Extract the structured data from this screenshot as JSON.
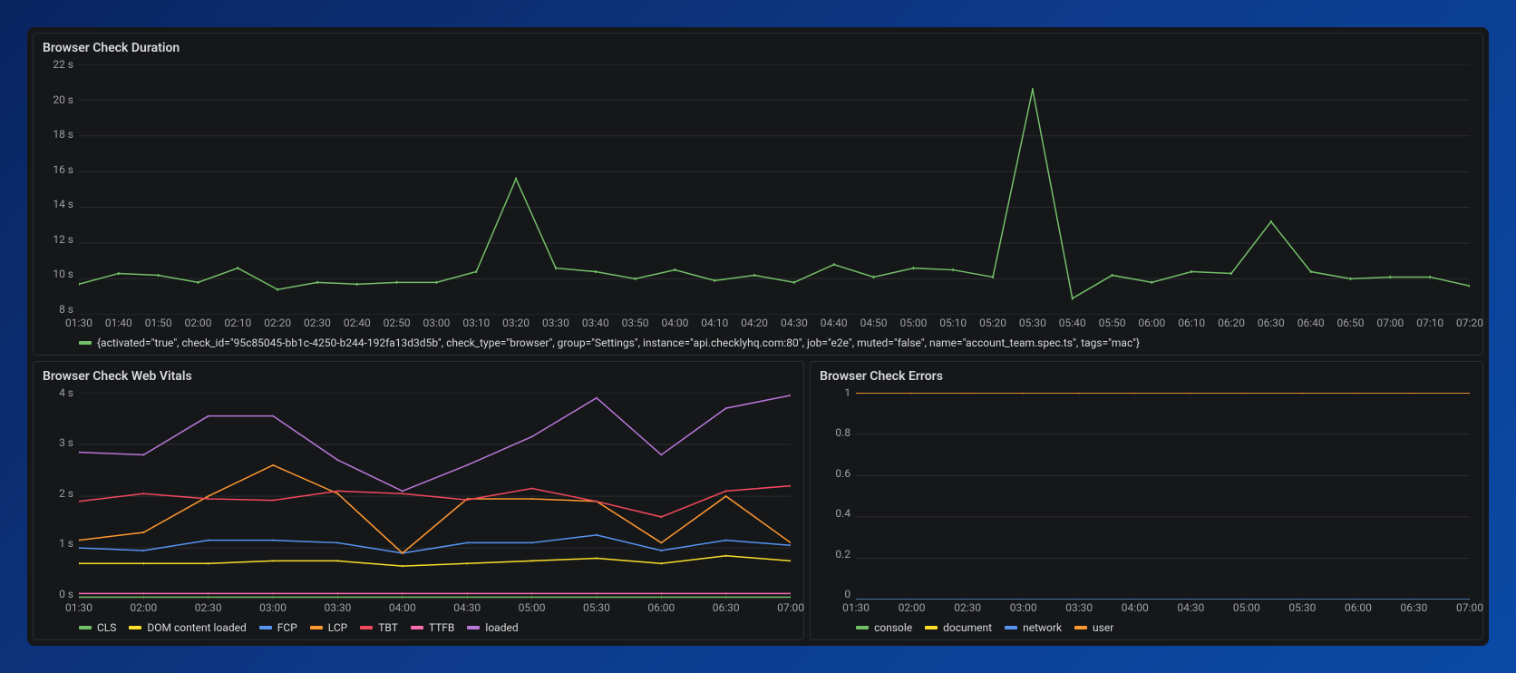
{
  "panels": {
    "duration": {
      "title": "Browser Check Duration"
    },
    "vitals": {
      "title": "Browser Check Web Vitals"
    },
    "errors": {
      "title": "Browser Check Errors"
    }
  },
  "colors": {
    "green": "#73bf69",
    "yellow": "#fade2a",
    "blue": "#5794f2",
    "orange": "#ff9830",
    "red": "#f2495c",
    "teal": "#19d4d4",
    "pink": "#fa6db0",
    "purple": "#b877d9"
  },
  "chart_data": [
    {
      "id": "duration",
      "type": "line",
      "title": "Browser Check Duration",
      "xlabel": "",
      "ylabel": "",
      "ylim": [
        8,
        22
      ],
      "yticks": [
        "22 s",
        "20 s",
        "18 s",
        "16 s",
        "14 s",
        "12 s",
        "10 s",
        "8 s"
      ],
      "categories": [
        "01:30",
        "01:40",
        "01:50",
        "02:00",
        "02:10",
        "02:20",
        "02:30",
        "02:40",
        "02:50",
        "03:00",
        "03:10",
        "03:20",
        "03:30",
        "03:40",
        "03:50",
        "04:00",
        "04:10",
        "04:20",
        "04:30",
        "04:40",
        "04:50",
        "05:00",
        "05:10",
        "05:20",
        "05:30",
        "05:40",
        "05:50",
        "06:00",
        "06:10",
        "06:20",
        "06:30",
        "06:40",
        "06:50",
        "07:00",
        "07:10",
        "07:20"
      ],
      "series": [
        {
          "name": "{activated=\"true\", check_id=\"95c85045-bb1c-4250-b244-192fa13d3d5b\", check_type=\"browser\", group=\"Settings\", instance=\"api.checklyhq.com:80\", job=\"e2e\", muted=\"false\", name=\"account_team.spec.ts\", tags=\"mac\"}",
          "color": "green",
          "values": [
            9.7,
            10.3,
            10.2,
            9.8,
            10.6,
            9.4,
            9.8,
            9.7,
            9.8,
            9.8,
            10.4,
            15.6,
            10.6,
            10.4,
            10.0,
            10.5,
            9.9,
            10.2,
            9.8,
            10.8,
            10.1,
            10.6,
            10.5,
            10.1,
            20.6,
            8.9,
            10.2,
            9.8,
            10.4,
            10.3,
            13.2,
            10.4,
            10.0,
            10.1,
            10.1,
            9.6
          ]
        }
      ]
    },
    {
      "id": "vitals",
      "type": "line",
      "title": "Browser Check Web Vitals",
      "ylim": [
        0,
        4
      ],
      "yticks": [
        "4 s",
        "3 s",
        "2 s",
        "1 s",
        "0 s"
      ],
      "categories": [
        "01:30",
        "02:00",
        "02:30",
        "03:00",
        "03:30",
        "04:00",
        "04:30",
        "05:00",
        "05:30",
        "06:00",
        "06:30",
        "07:00"
      ],
      "series": [
        {
          "name": "CLS",
          "color": "green",
          "values": [
            0.05,
            0.05,
            0.05,
            0.05,
            0.05,
            0.05,
            0.05,
            0.05,
            0.05,
            0.05,
            0.05,
            0.05
          ]
        },
        {
          "name": "DOM content loaded",
          "color": "yellow",
          "values": [
            0.7,
            0.7,
            0.7,
            0.75,
            0.75,
            0.65,
            0.7,
            0.75,
            0.8,
            0.7,
            0.85,
            0.75
          ]
        },
        {
          "name": "FCP",
          "color": "blue",
          "values": [
            1.0,
            0.95,
            1.15,
            1.15,
            1.1,
            0.9,
            1.1,
            1.1,
            1.25,
            0.95,
            1.15,
            1.05
          ]
        },
        {
          "name": "LCP",
          "color": "orange",
          "values": [
            1.15,
            1.3,
            2.0,
            2.6,
            2.05,
            0.9,
            1.95,
            1.95,
            1.9,
            1.1,
            2.0,
            1.1
          ]
        },
        {
          "name": "TBT",
          "color": "red",
          "values": [
            1.9,
            2.05,
            1.95,
            1.92,
            2.1,
            2.05,
            1.93,
            2.15,
            1.9,
            1.6,
            2.1,
            2.2
          ]
        },
        {
          "name": "TTFB",
          "color": "pink",
          "values": [
            0.12,
            0.12,
            0.12,
            0.12,
            0.12,
            0.12,
            0.12,
            0.12,
            0.12,
            0.12,
            0.12,
            0.12
          ]
        },
        {
          "name": "loaded",
          "color": "purple",
          "values": [
            2.85,
            2.8,
            3.55,
            3.55,
            2.7,
            2.1,
            2.6,
            3.15,
            3.9,
            2.8,
            3.7,
            3.95
          ]
        }
      ]
    },
    {
      "id": "errors",
      "type": "line",
      "title": "Browser Check Errors",
      "ylim": [
        0,
        1
      ],
      "yticks": [
        "1",
        "0.8",
        "0.6",
        "0.4",
        "0.2",
        "0"
      ],
      "categories": [
        "01:30",
        "02:00",
        "02:30",
        "03:00",
        "03:30",
        "04:00",
        "04:30",
        "05:00",
        "05:30",
        "06:00",
        "06:30",
        "07:00"
      ],
      "series": [
        {
          "name": "console",
          "color": "green",
          "values": [
            0,
            0,
            0,
            0,
            0,
            0,
            0,
            0,
            0,
            0,
            0,
            0
          ]
        },
        {
          "name": "document",
          "color": "yellow",
          "values": [
            1,
            1,
            1,
            1,
            1,
            1,
            1,
            1,
            1,
            1,
            1,
            1
          ]
        },
        {
          "name": "network",
          "color": "blue",
          "values": [
            0,
            0,
            0,
            0,
            0,
            0,
            0,
            0,
            0,
            0,
            0,
            0
          ]
        },
        {
          "name": "user",
          "color": "orange",
          "values": [
            1,
            1,
            1,
            1,
            1,
            1,
            1,
            1,
            1,
            1,
            1,
            1
          ]
        }
      ]
    }
  ]
}
